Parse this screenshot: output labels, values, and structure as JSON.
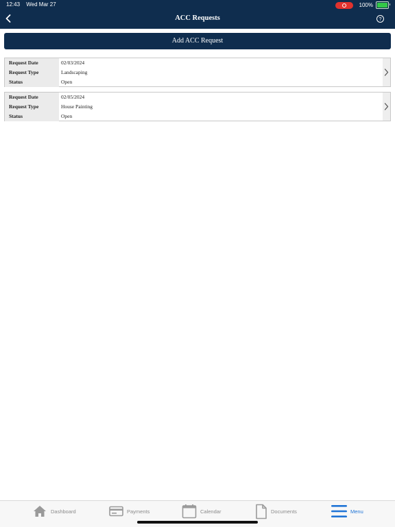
{
  "status_bar": {
    "time": "12:43",
    "date": "Wed Mar 27",
    "battery": "100%"
  },
  "header": {
    "title": "ACC Requests"
  },
  "add_button_label": "Add ACC Request",
  "requests": [
    {
      "request_date_label": "Request Date",
      "request_date": "02/03/2024",
      "request_type_label": "Request Type",
      "request_type": "Landscaping",
      "status_label": "Status",
      "status": "Open"
    },
    {
      "request_date_label": "Request Date",
      "request_date": "02/05/2024",
      "request_type_label": "Request Type",
      "request_type": "House Painting",
      "status_label": "Status",
      "status": "Open"
    }
  ],
  "tabs": [
    {
      "label": "Dashboard",
      "icon": "home-icon"
    },
    {
      "label": "Payments",
      "icon": "credit-card-icon"
    },
    {
      "label": "Calendar",
      "icon": "calendar-icon"
    },
    {
      "label": "Documents",
      "icon": "document-icon"
    },
    {
      "label": "Menu",
      "icon": "menu-icon",
      "active": true
    }
  ],
  "colors": {
    "header_bg": "#0f2d4e",
    "active_tab": "#1f74d6",
    "inactive_tab": "#8b8b8b"
  }
}
